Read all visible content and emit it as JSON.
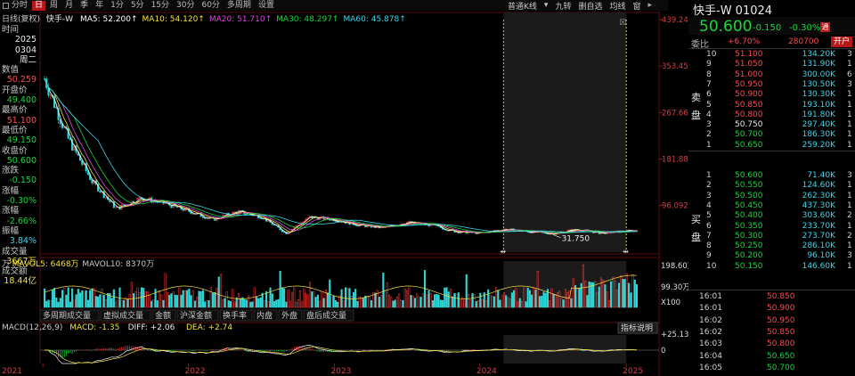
{
  "toolbar": {
    "tabs": [
      {
        "label": "分时",
        "active": false
      },
      {
        "label": "日",
        "active": true
      },
      {
        "label": "周",
        "active": false
      },
      {
        "label": "月",
        "active": false
      },
      {
        "label": "季",
        "active": false
      },
      {
        "label": "年",
        "active": false
      },
      {
        "label": "1分",
        "active": false
      },
      {
        "label": "5分",
        "active": false
      },
      {
        "label": "15分",
        "active": false
      },
      {
        "label": "30分",
        "active": false
      },
      {
        "label": "60分",
        "active": false
      },
      {
        "label": "多周期",
        "active": false
      },
      {
        "label": "设置",
        "active": false
      }
    ],
    "right": {
      "kline_type": "普通K线",
      "nine_turn": "九转",
      "self_select": "删自选",
      "average": "均线",
      "window": "窗"
    }
  },
  "ma_legend": {
    "mode": "日线(复权)",
    "stock": "快手-W",
    "items": [
      {
        "label": "MA5: 52.200",
        "color": "#ffffff"
      },
      {
        "label": "MA10: 54.120",
        "color": "#f0e040"
      },
      {
        "label": "MA20: 51.710",
        "color": "#e043e0"
      },
      {
        "label": "MA30: 48.297",
        "color": "#18d63c"
      },
      {
        "label": "MA60: 45.878",
        "color": "#3ed4e8"
      }
    ]
  },
  "left_info": [
    {
      "label": "时间",
      "value": "",
      "cls": "lbl"
    },
    {
      "label": "2025",
      "value": "",
      "cls": "wht"
    },
    {
      "label": "0304",
      "value": "",
      "cls": "wht"
    },
    {
      "label": "周二",
      "value": "",
      "cls": "wht"
    },
    {
      "label": "数值",
      "value": "",
      "cls": "lbl"
    },
    {
      "label": "50.259",
      "value": "",
      "cls": "red"
    },
    {
      "label": "开盘价",
      "value": "",
      "cls": "lbl"
    },
    {
      "label": "49.400",
      "value": "",
      "cls": "grn"
    },
    {
      "label": "最高价",
      "value": "",
      "cls": "lbl"
    },
    {
      "label": "51.100",
      "value": "",
      "cls": "red"
    },
    {
      "label": "最低价",
      "value": "",
      "cls": "lbl"
    },
    {
      "label": "49.150",
      "value": "",
      "cls": "grn"
    },
    {
      "label": "收盘价",
      "value": "",
      "cls": "lbl"
    },
    {
      "label": "50.600",
      "value": "",
      "cls": "grn"
    },
    {
      "label": "涨跌",
      "value": "",
      "cls": "lbl"
    },
    {
      "label": "-0.150",
      "value": "",
      "cls": "grn"
    },
    {
      "label": "涨幅",
      "value": "",
      "cls": "lbl"
    },
    {
      "label": "-0.30%",
      "value": "",
      "cls": "grn"
    },
    {
      "label": "涨幅",
      "value": "",
      "cls": "lbl"
    },
    {
      "label": "-2.66%",
      "value": "",
      "cls": "grn"
    },
    {
      "label": "振幅",
      "value": "",
      "cls": "lbl"
    },
    {
      "label": "3.84%",
      "value": "",
      "cls": "cyn"
    },
    {
      "label": "成交量",
      "value": "",
      "cls": "lbl"
    },
    {
      "label": "3667万",
      "value": "",
      "cls": "yel"
    },
    {
      "label": "成交额",
      "value": "",
      "cls": "lbl"
    },
    {
      "label": "18.44亿",
      "value": "",
      "cls": "yel"
    }
  ],
  "chart_data": {
    "type": "candlestick",
    "price_axis": {
      "ticks": [
        "439.247",
        "353.458",
        "267.669",
        "181.881",
        "96.092"
      ],
      "ylim": [
        10,
        439.247
      ]
    },
    "low_label": "31.750",
    "x_ticks": [
      "2021",
      "2022",
      "2023",
      "2024",
      "2025"
    ],
    "price_series": {
      "name": "close",
      "x": [
        "2021-02",
        "2021-04",
        "2021-06",
        "2021-08",
        "2021-10",
        "2021-12",
        "2022-02",
        "2022-04",
        "2022-06",
        "2022-08",
        "2022-10",
        "2022-12",
        "2023-02",
        "2023-04",
        "2023-06",
        "2023-08",
        "2023-10",
        "2023-12",
        "2024-02",
        "2024-04",
        "2024-06",
        "2024-08",
        "2024-10",
        "2024-12",
        "2025-03"
      ],
      "values": [
        330,
        220,
        140,
        90,
        110,
        100,
        85,
        70,
        85,
        75,
        45,
        75,
        70,
        60,
        55,
        65,
        60,
        48,
        45,
        52,
        48,
        44,
        52,
        45,
        50.6
      ]
    },
    "volume_axis": {
      "ticks": [
        "198.60万",
        "99.30万",
        "X100"
      ]
    },
    "volume_legend": [
      {
        "label": "万",
        "color": "#c8c8c8"
      },
      {
        "label": "MAVOL5: 6468万",
        "color": "#f0e040"
      },
      {
        "label": "MAVOL10: 8370万",
        "color": "#c8c8c8"
      }
    ],
    "macd": {
      "legend": [
        {
          "label": "MACD(12,26,9)",
          "color": "#c8c8c8"
        },
        {
          "label": "MACD: -1.35",
          "color": "#f0e040"
        },
        {
          "label": "DIFF: +2.06",
          "color": "#eaeaea"
        },
        {
          "label": "DEA: +2.74",
          "color": "#f0e040"
        }
      ],
      "ticks": [
        "+25.13",
        "0"
      ]
    }
  },
  "sub_tabs": [
    "多周期成交量",
    "虚拟成交量",
    "金额",
    "沪深金额",
    "换手率",
    "内盘",
    "外盘",
    "盘后成交量"
  ],
  "indicator_button": "指标说明",
  "quote": {
    "name": "快手-W 01024",
    "price": "50.600",
    "change": "-0.150",
    "pct": "-0.30%",
    "badge": "通",
    "wei_bi_label": "委比",
    "wei_bi": "+6.70%",
    "wei_cha": "280700",
    "action": "开户",
    "sell_label": [
      "卖",
      "盘"
    ],
    "buy_label": [
      "买",
      "盘"
    ],
    "asks": [
      {
        "lvl": "10",
        "price": "51.100",
        "vol": "134.20K",
        "n": "3"
      },
      {
        "lvl": "9",
        "price": "51.050",
        "vol": "131.90K",
        "n": "1"
      },
      {
        "lvl": "8",
        "price": "51.000",
        "vol": "300.00K",
        "n": "6"
      },
      {
        "lvl": "7",
        "price": "50.950",
        "vol": "130.50K",
        "n": "3"
      },
      {
        "lvl": "6",
        "price": "50.900",
        "vol": "130.30K",
        "n": "1"
      },
      {
        "lvl": "5",
        "price": "50.850",
        "vol": "193.10K",
        "n": "1"
      },
      {
        "lvl": "4",
        "price": "50.800",
        "vol": "191.80K",
        "n": "1"
      },
      {
        "lvl": "3",
        "price": "50.750",
        "vol": "297.40K",
        "n": "1"
      },
      {
        "lvl": "2",
        "price": "50.700",
        "vol": "186.30K",
        "n": "1"
      },
      {
        "lvl": "1",
        "price": "50.650",
        "vol": "259.20K",
        "n": "1"
      }
    ],
    "bids": [
      {
        "lvl": "1",
        "price": "50.600",
        "vol": "71.40K",
        "n": "3"
      },
      {
        "lvl": "2",
        "price": "50.550",
        "vol": "124.60K",
        "n": "1"
      },
      {
        "lvl": "3",
        "price": "50.500",
        "vol": "262.30K",
        "n": "1"
      },
      {
        "lvl": "4",
        "price": "50.450",
        "vol": "437.30K",
        "n": "1"
      },
      {
        "lvl": "5",
        "price": "50.400",
        "vol": "303.60K",
        "n": "2"
      },
      {
        "lvl": "6",
        "price": "50.350",
        "vol": "233.70K",
        "n": "1"
      },
      {
        "lvl": "7",
        "price": "50.300",
        "vol": "273.70K",
        "n": "2"
      },
      {
        "lvl": "8",
        "price": "50.250",
        "vol": "286.10K",
        "n": "1"
      },
      {
        "lvl": "9",
        "price": "50.200",
        "vol": "96.10K",
        "n": "3"
      },
      {
        "lvl": "10",
        "price": "50.150",
        "vol": "146.60K",
        "n": "1"
      }
    ],
    "trades": [
      {
        "time": "16:01",
        "price": "50.850",
        "cls": "red"
      },
      {
        "time": "16:01",
        "price": "50.900",
        "cls": "red"
      },
      {
        "time": "16:02",
        "price": "50.950",
        "cls": "red"
      },
      {
        "time": "16:02",
        "price": "50.850",
        "cls": "red"
      },
      {
        "time": "16:03",
        "price": "50.800",
        "cls": "red"
      },
      {
        "time": "16:04",
        "price": "50.650",
        "cls": "grn"
      },
      {
        "time": "16:05",
        "price": "50.700",
        "cls": "grn"
      }
    ]
  }
}
